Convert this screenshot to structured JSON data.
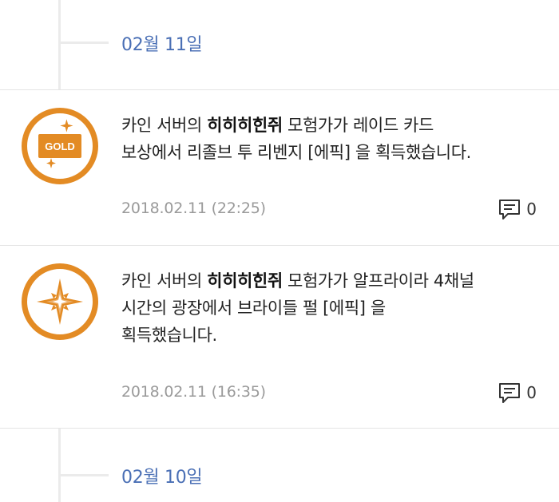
{
  "dates": [
    {
      "label": "02월 11일"
    },
    {
      "label": "02월 10일"
    }
  ],
  "items": [
    {
      "badge_icon": "gold-bar-icon",
      "badge_text": "GOLD",
      "server": "카인 서버의",
      "character": "히히히힌쥐",
      "line1_rest": "모험가가 레이드 카드",
      "line2": "보상에서 리졸브 투 리벤지 [에픽] 을 획득했습니다.",
      "line3": "",
      "timestamp": "2018.02.11 (22:25)",
      "comment_count": "0"
    },
    {
      "badge_icon": "sparkle-star-icon",
      "badge_text": "",
      "server": "카인 서버의",
      "character": "히히히힌쥐",
      "line1_rest": "모험가가 알프라이라 4채널",
      "line2": "시간의 광장에서 브라이들 펄 [에픽] 을",
      "line3": "획득했습니다.",
      "timestamp": "2018.02.11 (16:35)",
      "comment_count": "0"
    }
  ],
  "colors": {
    "accent": "#e38b24",
    "date": "#4a6fb5",
    "timestamp": "#9a9a9a"
  }
}
